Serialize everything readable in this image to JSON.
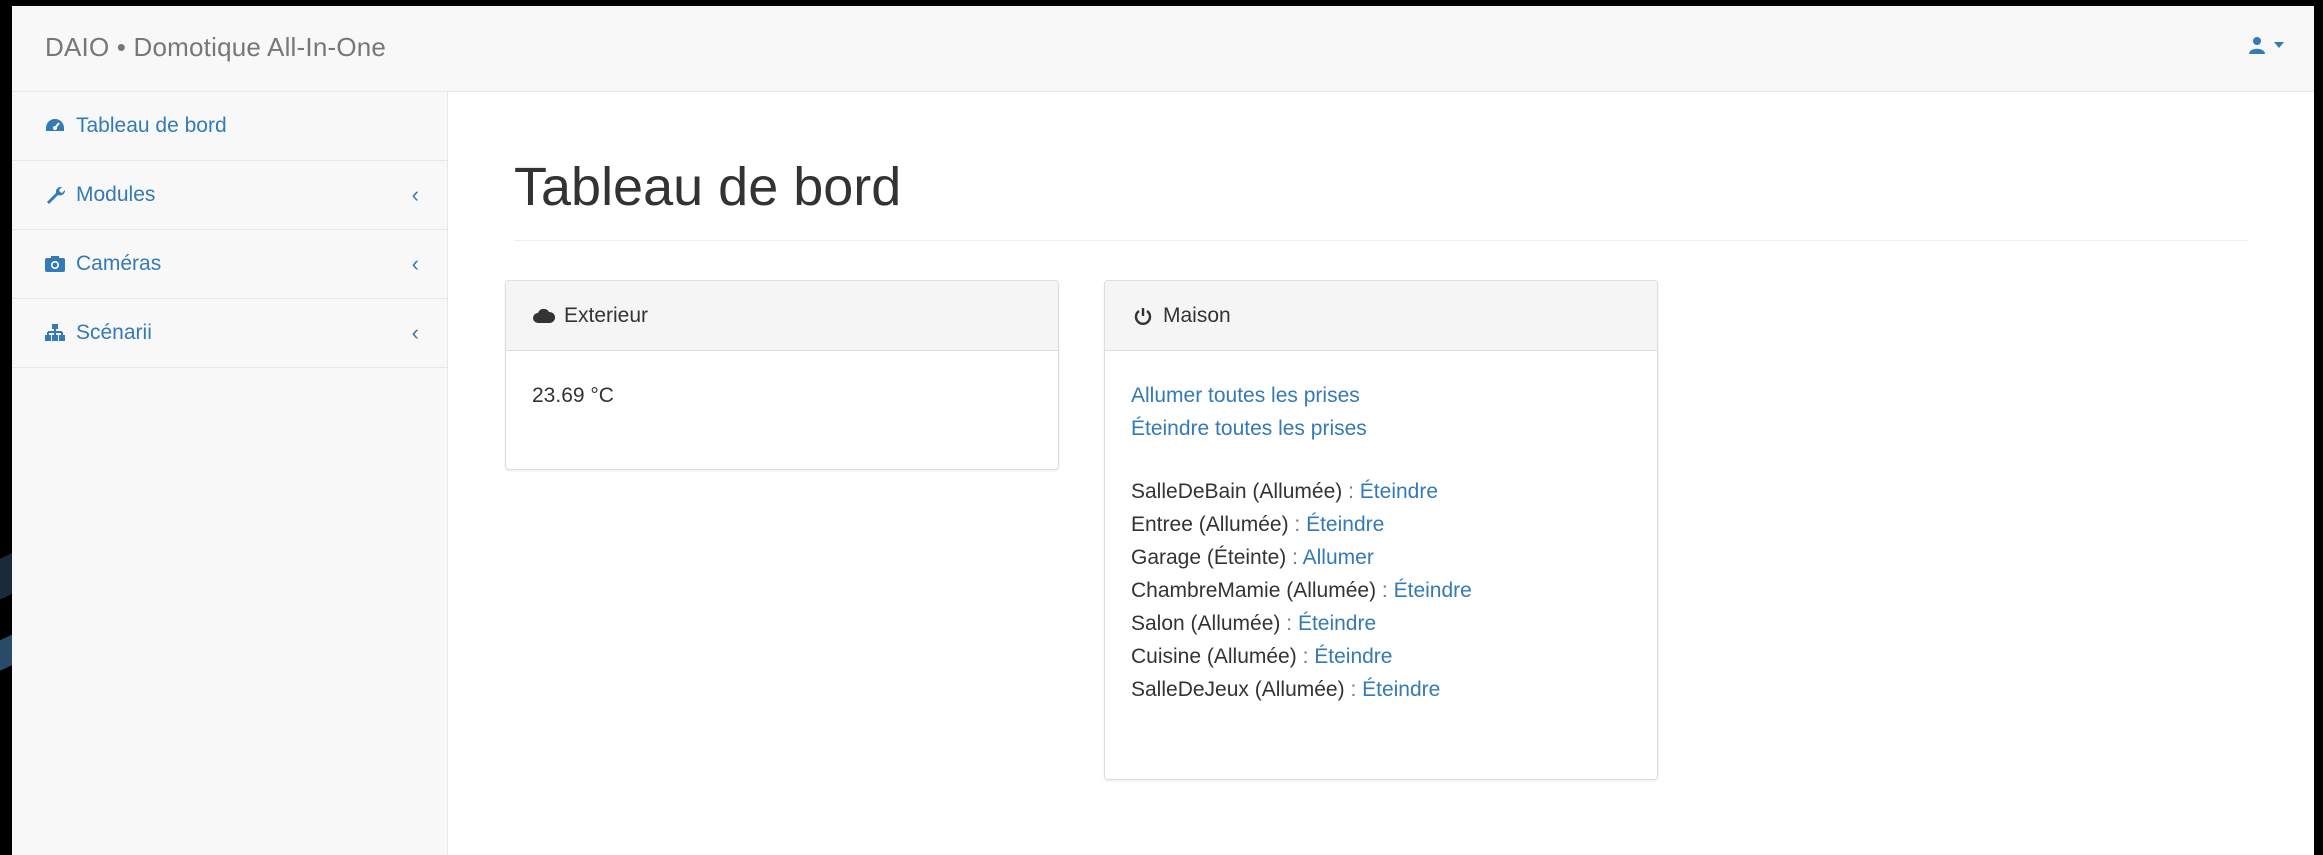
{
  "app": {
    "brand": "DAIO • Domotique All-In-One"
  },
  "sidebar": {
    "items": [
      {
        "label": "Tableau de bord",
        "icon": "dashboard-icon",
        "has_chevron": false
      },
      {
        "label": "Modules",
        "icon": "wrench-icon",
        "has_chevron": true
      },
      {
        "label": "Caméras",
        "icon": "camera-icon",
        "has_chevron": true
      },
      {
        "label": "Scénarii",
        "icon": "sitemap-icon",
        "has_chevron": true
      }
    ],
    "chevron": "‹"
  },
  "main": {
    "title": "Tableau de bord",
    "exterior": {
      "heading": "Exterieur",
      "temperature": "23.69 °C"
    },
    "house": {
      "heading": "Maison",
      "all_on": "Allumer toutes les prises",
      "all_off": "Éteindre toutes les prises",
      "devices": [
        {
          "name": "SalleDeBain (Allumée)",
          "action": "Éteindre"
        },
        {
          "name": "Entree (Allumée)",
          "action": "Éteindre"
        },
        {
          "name": "Garage (Éteinte)",
          "action": "Allumer"
        },
        {
          "name": "ChambreMamie (Allumée)",
          "action": "Éteindre"
        },
        {
          "name": "Salon (Allumée)",
          "action": "Éteindre"
        },
        {
          "name": "Cuisine (Allumée)",
          "action": "Éteindre"
        },
        {
          "name": "SalleDeJeux (Allumée)",
          "action": "Éteindre"
        }
      ],
      "separator": ":"
    }
  },
  "colors": {
    "link": "#337ab7",
    "navbar_bg": "#f8f8f8",
    "panel_heading_bg": "#f5f5f5"
  }
}
